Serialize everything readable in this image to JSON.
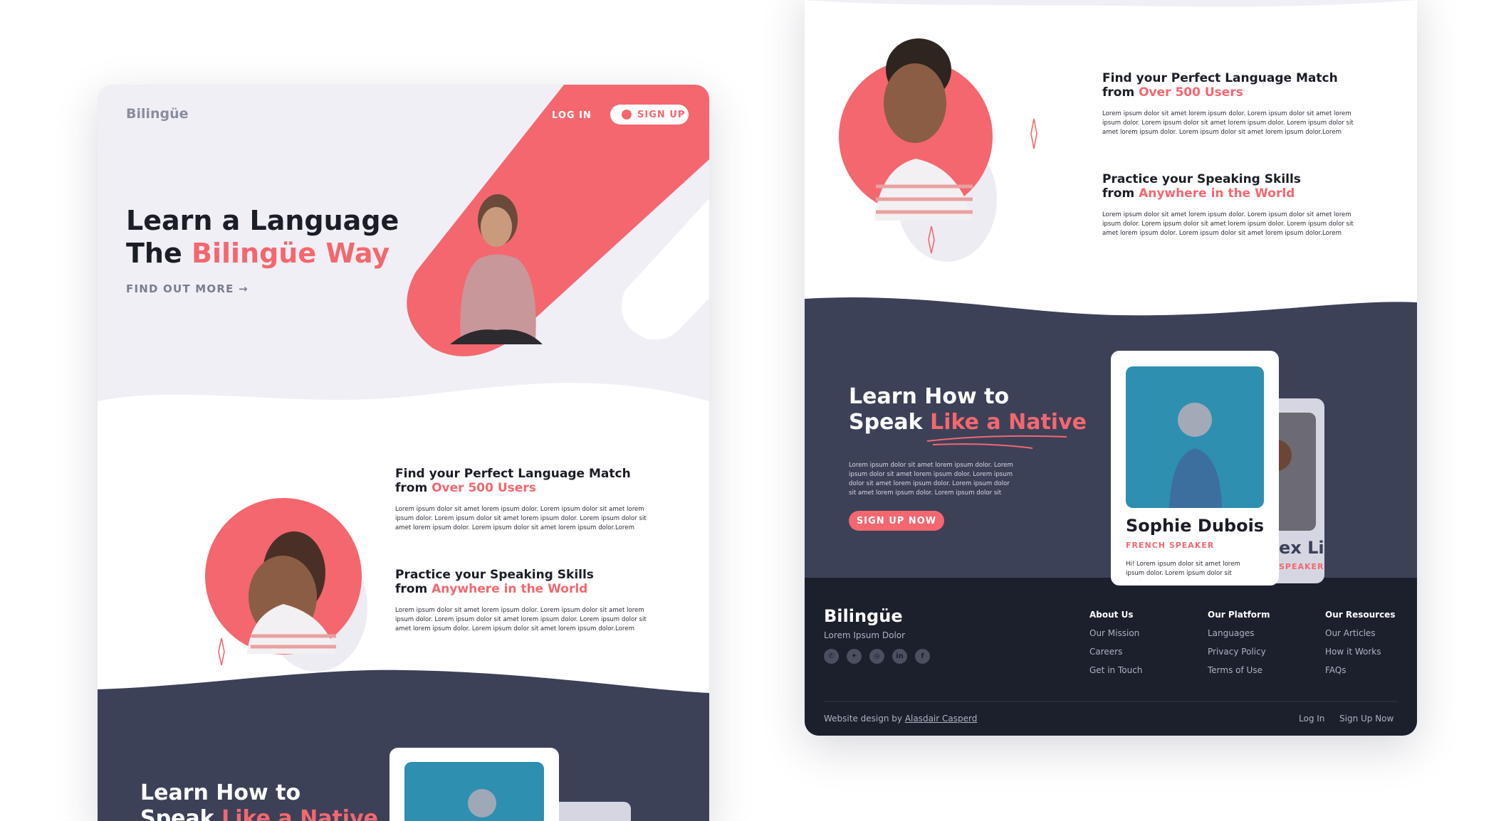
{
  "brand": {
    "name": "Bilingüe",
    "pink": "#f4676f",
    "navy": "#3c4158",
    "dark": "#1c1f2c"
  },
  "nav": {
    "login": "LOG IN",
    "signup": "SIGN UP"
  },
  "hero": {
    "title_line1": "Learn a Language",
    "title_line2_prefix": "The ",
    "title_line2_highlight": "Bilingüe Way",
    "cta": "FIND OUT MORE",
    "cta_arrow": "→"
  },
  "features": [
    {
      "title": "Find your Perfect Language Match",
      "from": "from ",
      "highlight": "Over 500 Users",
      "body": [
        "Lorem ipsum dolor sit amet lorem ipsum dolor. Lorem ipsum dolor sit amet lorem",
        "ipsum dolor. Lorem ipsum dolor sit amet lorem ipsum dolor. Lorem ipsum dolor sit",
        "amet lorem ipsum dolor. Lorem ipsum dolor sit amet lorem ipsum dolor.Lorem"
      ]
    },
    {
      "title": "Practice your Speaking Skills",
      "from": "from ",
      "highlight": "Anywhere in the World",
      "body": [
        "Lorem ipsum dolor sit amet lorem ipsum dolor. Lorem ipsum dolor sit amet lorem",
        "ipsum dolor. Lorem ipsum dolor sit amet lorem ipsum dolor. Lorem ipsum dolor sit",
        "amet lorem ipsum dolor. Lorem ipsum dolor sit amet lorem ipsum dolor.Lorem"
      ]
    }
  ],
  "native": {
    "line1": "Learn How to",
    "line2_prefix": "Speak ",
    "line2_highlight": "Like a Native",
    "body": [
      "Lorem ipsum dolor sit amet lorem ipsum dolor. Lorem",
      "ipsum dolor sit amet lorem ipsum dolor. Lorem ipsum",
      "dolor sit amet lorem ipsum dolor. Lorem ipsum dolor",
      "sit amet lorem ipsum dolor. Lorem ipsum dolor sit"
    ],
    "button": "SIGN UP NOW"
  },
  "speakers": [
    {
      "name": "Sophie Dubois",
      "role": "FRENCH SPEAKER",
      "bio": "Hi! Lorem ipsum dolor sit amet lorem",
      "bio2": "ipsum dolor. Lorem ipsum dolor sit amet"
    },
    {
      "name": "ex Liu",
      "role": "SPEAKER"
    }
  ],
  "footer": {
    "tagline": "Lorem Ipsum Dolor",
    "social": [
      "whatsapp-icon",
      "twitter-icon",
      "instagram-icon",
      "linkedin-icon",
      "facebook-icon"
    ],
    "social_glyphs": [
      "✆",
      "✦",
      "◎",
      "in",
      "f"
    ],
    "columns": [
      {
        "title": "About Us",
        "links": [
          "Our Mission",
          "Careers",
          "Get in Touch"
        ]
      },
      {
        "title": "Our Platform",
        "links": [
          "Languages",
          "Privacy Policy",
          "Terms of Use"
        ]
      },
      {
        "title": "Our Resources",
        "links": [
          "Our Articles",
          "How it Works",
          "FAQs"
        ]
      }
    ],
    "credit_prefix": "Website design by ",
    "credit_name": "Alasdair Casperd",
    "login": "Log In",
    "signup": "Sign Up Now"
  }
}
